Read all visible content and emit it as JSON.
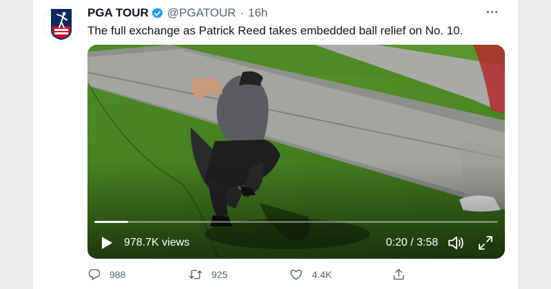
{
  "tweet": {
    "display_name": "PGA TOUR",
    "handle": "@PGATOUR",
    "separator": "·",
    "time": "16h",
    "text": "The full exchange as Patrick Reed takes embedded ball relief on No. 10.",
    "verified": true
  },
  "video": {
    "views": "978.7K views",
    "timecode": "0:20 / 3:58",
    "progress": 0.084
  },
  "actions": {
    "reply_count": "988",
    "retweet_count": "925",
    "like_count": "4.4K"
  },
  "colors": {
    "brand_blue": "#1d9bf0",
    "secondary_text": "#536471",
    "pga_navy": "#0b2a5b",
    "pga_red": "#c8102e"
  },
  "icons": [
    "pga-tour-logo",
    "verified-badge-icon",
    "more-icon",
    "play-icon",
    "volume-icon",
    "fullscreen-icon",
    "reply-icon",
    "retweet-icon",
    "like-icon",
    "share-icon"
  ]
}
